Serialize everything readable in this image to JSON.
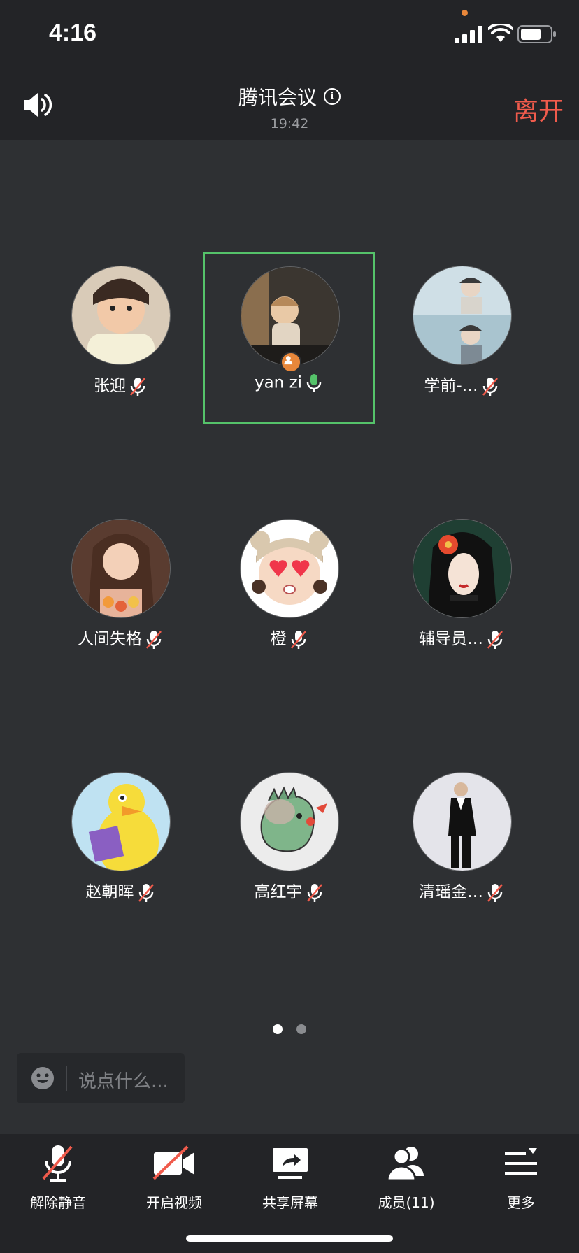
{
  "status_bar": {
    "time": "4:16"
  },
  "header": {
    "title": "腾讯会议",
    "meeting_time": "19:42",
    "leave_label": "离开"
  },
  "participants": [
    {
      "name": "张迎",
      "mic": "muted"
    },
    {
      "name": "yan zi",
      "mic": "on",
      "active": true,
      "host": true
    },
    {
      "name": "学前-…",
      "mic": "muted"
    },
    {
      "name": "人间失格",
      "mic": "muted"
    },
    {
      "name": "橙",
      "mic": "muted"
    },
    {
      "name": "辅导员…",
      "mic": "muted"
    },
    {
      "name": "赵朝晖",
      "mic": "muted"
    },
    {
      "name": "高红宇",
      "mic": "muted"
    },
    {
      "name": "清瑶金…",
      "mic": "muted"
    }
  ],
  "pager": {
    "current_page": 1,
    "total_pages": 2
  },
  "chat": {
    "placeholder": "说点什么..."
  },
  "toolbar": {
    "unmute_label": "解除静音",
    "video_label": "开启视频",
    "share_label": "共享屏幕",
    "members_label": "成员(11)",
    "more_label": "更多"
  },
  "colors": {
    "leave": "#f05b4c",
    "active_border": "#55c26a",
    "host_badge": "#e8873a"
  }
}
